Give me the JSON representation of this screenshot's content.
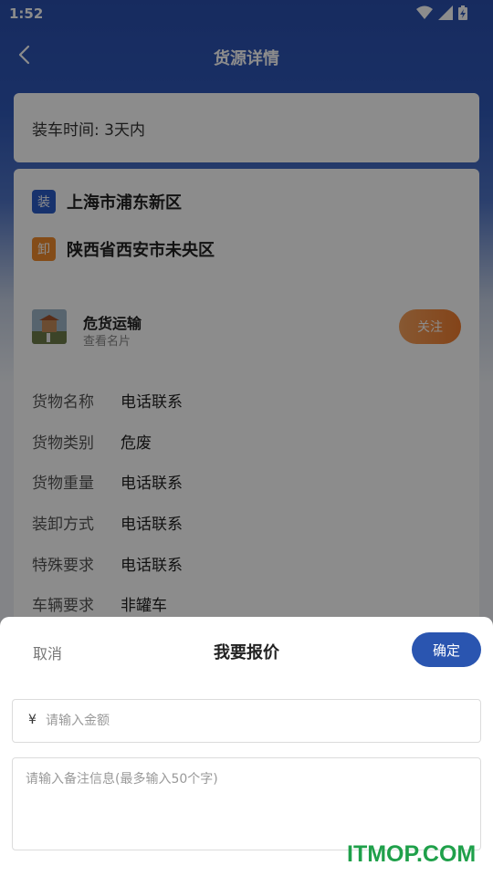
{
  "status_bar": {
    "time": "1:52"
  },
  "navbar": {
    "title": "货源详情",
    "back_icon": "chevron-left-icon"
  },
  "load_time": {
    "label": "装车时间: 3天内"
  },
  "route": {
    "load": {
      "badge": "装",
      "address": "上海市浦东新区",
      "color": "#2a5cc6"
    },
    "unload": {
      "badge": "卸",
      "address": "陕西省西安市未央区",
      "color": "#f08a2c"
    }
  },
  "shipper": {
    "name": "危货运输",
    "subtitle": "查看名片",
    "follow_label": "关注"
  },
  "details": [
    {
      "key": "货物名称",
      "value": "电话联系"
    },
    {
      "key": "货物类别",
      "value": "危废"
    },
    {
      "key": "货物重量",
      "value": "电话联系"
    },
    {
      "key": "装卸方式",
      "value": "电话联系"
    },
    {
      "key": "特殊要求",
      "value": "电话联系"
    },
    {
      "key": "车辆要求",
      "value": "非罐车"
    }
  ],
  "quote_sheet": {
    "cancel_label": "取消",
    "title": "我要报价",
    "confirm_label": "确定",
    "currency_symbol": "¥",
    "amount_placeholder": "请输入金额",
    "remark_placeholder": "请输入备注信息(最多输入50个字)"
  },
  "watermark": "ITMOP.COM",
  "colors": {
    "primary": "#2a55b0",
    "accent": "#f07c2e"
  }
}
